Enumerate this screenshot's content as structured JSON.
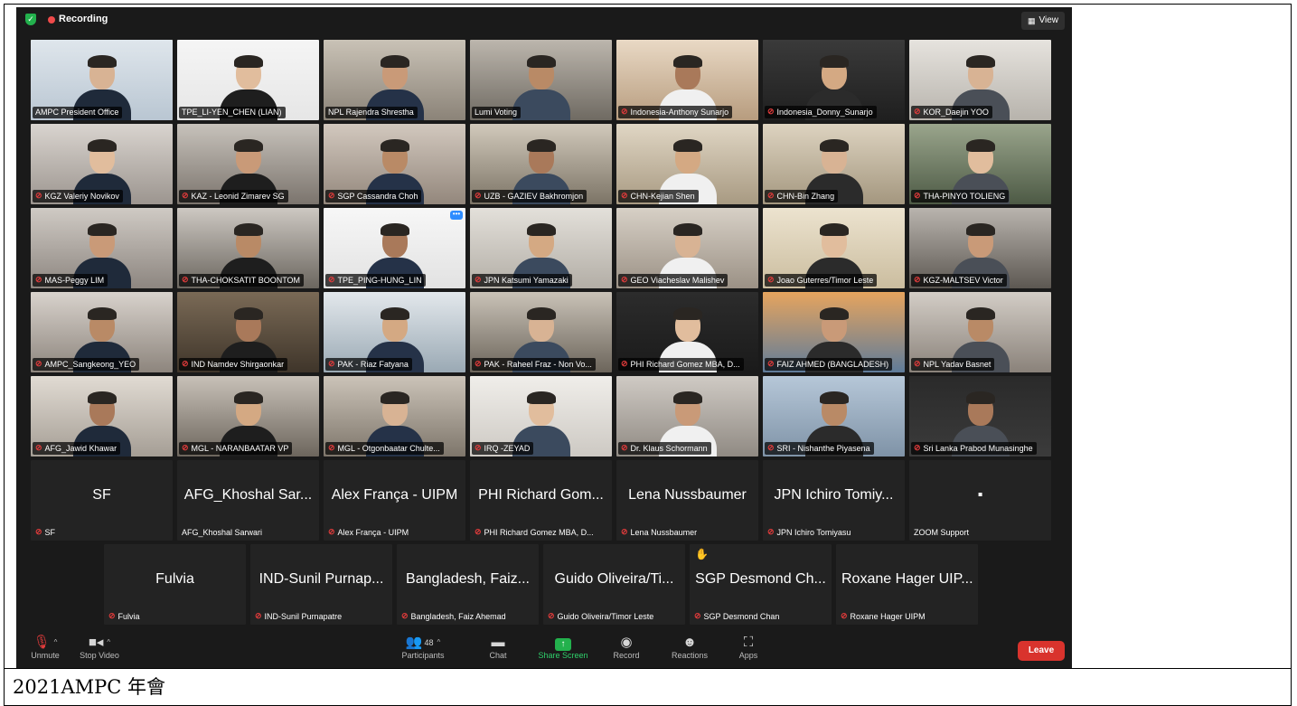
{
  "caption": "2021AMPC 年會",
  "top_bar": {
    "recording_label": "Recording",
    "view_label": "View"
  },
  "video_tiles": [
    "AMPC President Office",
    "TPE_LI-YEN_CHEN  (LIAN)",
    "NPL Rajendra Shrestha",
    "Lumi Voting",
    "Indonesia-Anthony Sunarjo",
    "Indonesia_Donny_Sunarjo",
    "KOR_Daejin YOO",
    "KGZ Valeriy Novikov",
    "KAZ - Leonid Zimarev SG",
    "SGP Cassandra Choh",
    "UZB - GAZIEV Bakhromjon",
    "CHN-Kejian Shen",
    "CHN-Bin Zhang",
    "THA-PINYO TOLIENG",
    "MAS-Peggy LIM",
    "THA-CHOKSATIT BOONTOM",
    "TPE_PING-HUNG_LIN",
    "JPN Katsumi Yamazaki",
    "GEO Viacheslav Malishev",
    "Joao  Guterres/Timor Leste",
    "KGZ-MALTSEV Victor",
    "AMPC_Sangkeong_YEO",
    "IND Namdev Shirgaonkar",
    "PAK - Riaz Fatyana",
    "PAK - Raheel Fraz - Non Vo...",
    "PHI Richard Gomez MBA, D...",
    "FAIZ AHMED (BANGLADESH)",
    "NPL Yadav Basnet",
    "AFG_Jawid Khawar",
    "MGL - NARANBAATAR VP",
    "MGL - Otgonbaatar Chulte...",
    "IRQ -ZEYAD",
    "Dr. Klaus Schormann",
    "SRI - Nishanthe Piyasena",
    "Sri Lanka Prabod Munasinghe"
  ],
  "name_tiles_row1": [
    {
      "big": "SF",
      "label": "SF"
    },
    {
      "big": "AFG_Khoshal Sar...",
      "label": "AFG_Khoshal Sarwari"
    },
    {
      "big": "Alex França - UIPM",
      "label": "Alex França - UIPM"
    },
    {
      "big": "PHI Richard Gom...",
      "label": "PHI Richard Gomez MBA, D..."
    },
    {
      "big": "Lena Nussbaumer",
      "label": "Lena Nussbaumer"
    },
    {
      "big": "JPN  Ichiro Tomiy...",
      "label": "JPN  Ichiro Tomiyasu"
    },
    {
      "big": "▪",
      "label": "ZOOM Support"
    }
  ],
  "name_tiles_row2": [
    {
      "big": "Fulvia",
      "label": "Fulvia"
    },
    {
      "big": "IND-Sunil Purnap...",
      "label": "IND-Sunil Purnapatre"
    },
    {
      "big": "Bangladesh, Faiz...",
      "label": "Bangladesh, Faiz Ahemad"
    },
    {
      "big": "Guido Oliveira/Ti...",
      "label": "Guido Oliveira/Timor Leste"
    },
    {
      "big": "SGP Desmond Ch...",
      "label": "SGP Desmond Chan"
    },
    {
      "big": "Roxane Hager UIP...",
      "label": "Roxane Hager UIPM"
    }
  ],
  "toolbar": {
    "unmute": "Unmute",
    "stop_video": "Stop Video",
    "participants": "Participants",
    "participants_count": "48",
    "chat": "Chat",
    "share_screen": "Share Screen",
    "record": "Record",
    "reactions": "Reactions",
    "apps": "Apps",
    "leave": "Leave"
  },
  "colors": {
    "meeting_bg": "#1a1a1a",
    "tile_bg": "#232323",
    "active_speaker": "#b5d36a",
    "recording_dot": "#ef4a4a",
    "share_green": "#23b14d",
    "leave_red": "#d9332d",
    "mute_red": "#e03b3b"
  },
  "icons": [
    "shield-icon",
    "grid-icon",
    "microphone-muted-icon",
    "video-camera-icon",
    "participants-icon",
    "chat-icon",
    "share-screen-icon",
    "record-icon",
    "reactions-icon",
    "apps-icon",
    "raised-hand-icon"
  ]
}
